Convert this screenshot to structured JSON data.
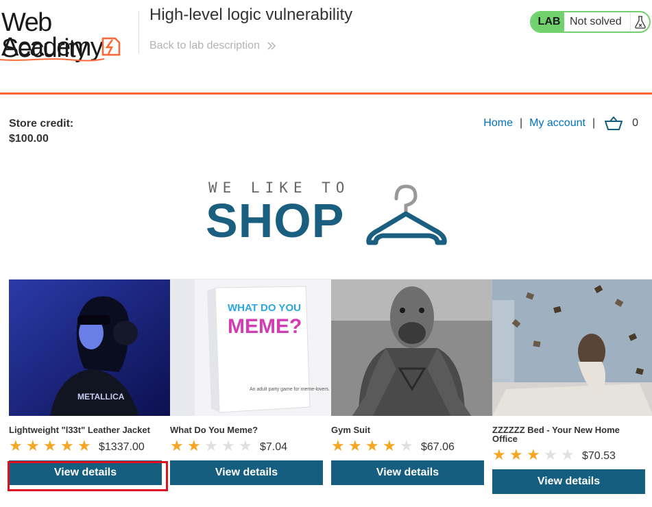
{
  "header": {
    "logo_line1": "Web Security",
    "logo_line2": "Academy",
    "lab_title": "High-level logic vulnerability",
    "back_link": "Back to lab description",
    "lab_badge": "LAB",
    "lab_status": "Not solved"
  },
  "store": {
    "credit_label": "Store credit:",
    "credit_value": "$100.00",
    "nav": {
      "home": "Home",
      "separator": "|",
      "account": "My account",
      "cart_count": "0"
    }
  },
  "banner": {
    "small": "WE LIKE TO",
    "big": "SHOP"
  },
  "products": [
    {
      "name": "Lightweight \"l33t\" Leather Jacket",
      "rating": 5,
      "price": "$1337.00",
      "button": "View details"
    },
    {
      "name": "What Do You Meme?",
      "rating": 2,
      "price": "$7.04",
      "button": "View details"
    },
    {
      "name": "Gym Suit",
      "rating": 4,
      "price": "$67.06",
      "button": "View details"
    },
    {
      "name": "ZZZZZZ Bed - Your New Home Office",
      "rating": 3,
      "price": "$70.53",
      "button": "View details"
    }
  ],
  "images": {
    "meme_box_line1": "WHAT DO YOU",
    "meme_box_line2": "MEME?",
    "meme_box_tag": "An adult party game for meme-lovers.",
    "jacket_shirt_text": "METALLICA"
  },
  "colors": {
    "accent": "#ff6633",
    "button": "#155e80",
    "link": "#0071bc",
    "lab_green": "#70d16d",
    "star": "#f5a623"
  }
}
